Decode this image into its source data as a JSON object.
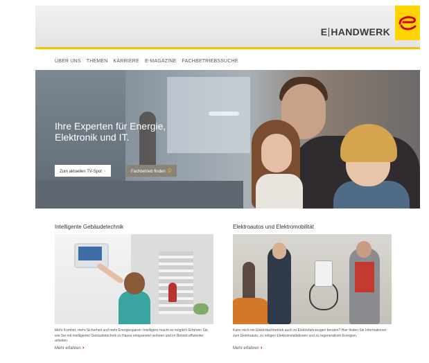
{
  "header": {
    "brand_prefix": "E",
    "brand_name": "HANDWERK",
    "accent_color": "#ffd400"
  },
  "nav": {
    "items": [
      "ÜBER UNS",
      "THEMEN",
      "KARRIERE",
      "E-MAGAZINE",
      "FACHBETRIEBSSUCHE"
    ]
  },
  "hero": {
    "title_line1": "Ihre Experten für Energie,",
    "title_line2": "Elektronik und IT.",
    "btn_tv": "Zum aktuellen TV-Spot",
    "btn_fach": "Fachbetrieb finden"
  },
  "teasers": [
    {
      "title": "Intelligente Gebäudetechnik",
      "text": "Mehr Komfort, mehr Sicherheit und mehr Energiesparen: Intelligenz macht es möglich! Erfahren Sie, wie Sie mit intelligenter Gebäudetechnik zu Hause entspannter wohnen und im Betrieb effizienter arbeiten.",
      "link": "Mehr erfahren"
    },
    {
      "title": "Elektroautos und Elektromobilität",
      "text": "Kann mich ein Elektrofachbetrieb auch zu Elektrofahrzeugen beraten? Hier finden Sie Informationen zum Elektroauto, zu nötigen Elektroinstallationen und zu regenerativen Energien.",
      "link": "Mehr erfahren"
    }
  ],
  "icons": [
    "e-handwerk-logo-icon",
    "chevron-right-icon",
    "search-icon"
  ]
}
